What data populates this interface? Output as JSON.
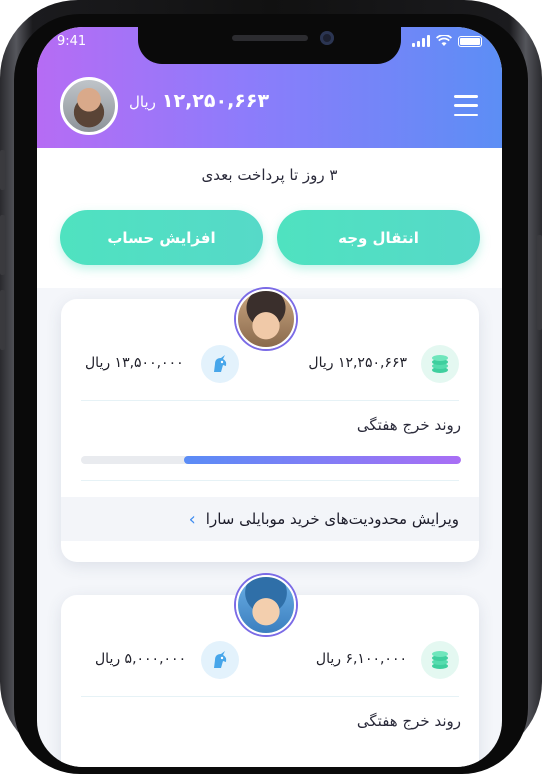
{
  "status_bar": {
    "time": "9:41"
  },
  "header": {
    "balance_value": "۱۲,۲۵۰,۶۶۳",
    "balance_unit": "ریال"
  },
  "due_text": "۳ روز تا پرداخت بعدی",
  "actions": {
    "transfer": "انتقال وجه",
    "top_up": "افزایش حساب"
  },
  "cards": [
    {
      "balance": "۱۲,۲۵۰,۶۶۳ ریال",
      "limit": "۱۳,۵۰۰,۰۰۰ ریال",
      "trend_label": "روند خرج هفتگی",
      "progress": 0.73,
      "edit_label": "ویرایش محدودیت‌های خرید موبایلی سارا"
    },
    {
      "balance": "۶,۱۰۰,۰۰۰ ریال",
      "limit": "۵,۰۰۰,۰۰۰ ریال",
      "trend_label": "روند خرج هفتگی"
    }
  ],
  "colors": {
    "header_start": "#b66cf4",
    "header_end": "#5c8ef5",
    "action": "#52dec4",
    "progress_start": "#5a8cf6",
    "progress_end": "#a96ef5"
  },
  "icons": [
    "menu-icon",
    "coins-icon",
    "unicorn-icon",
    "chevron-left-icon",
    "signal-icon",
    "wifi-icon",
    "battery-icon"
  ]
}
